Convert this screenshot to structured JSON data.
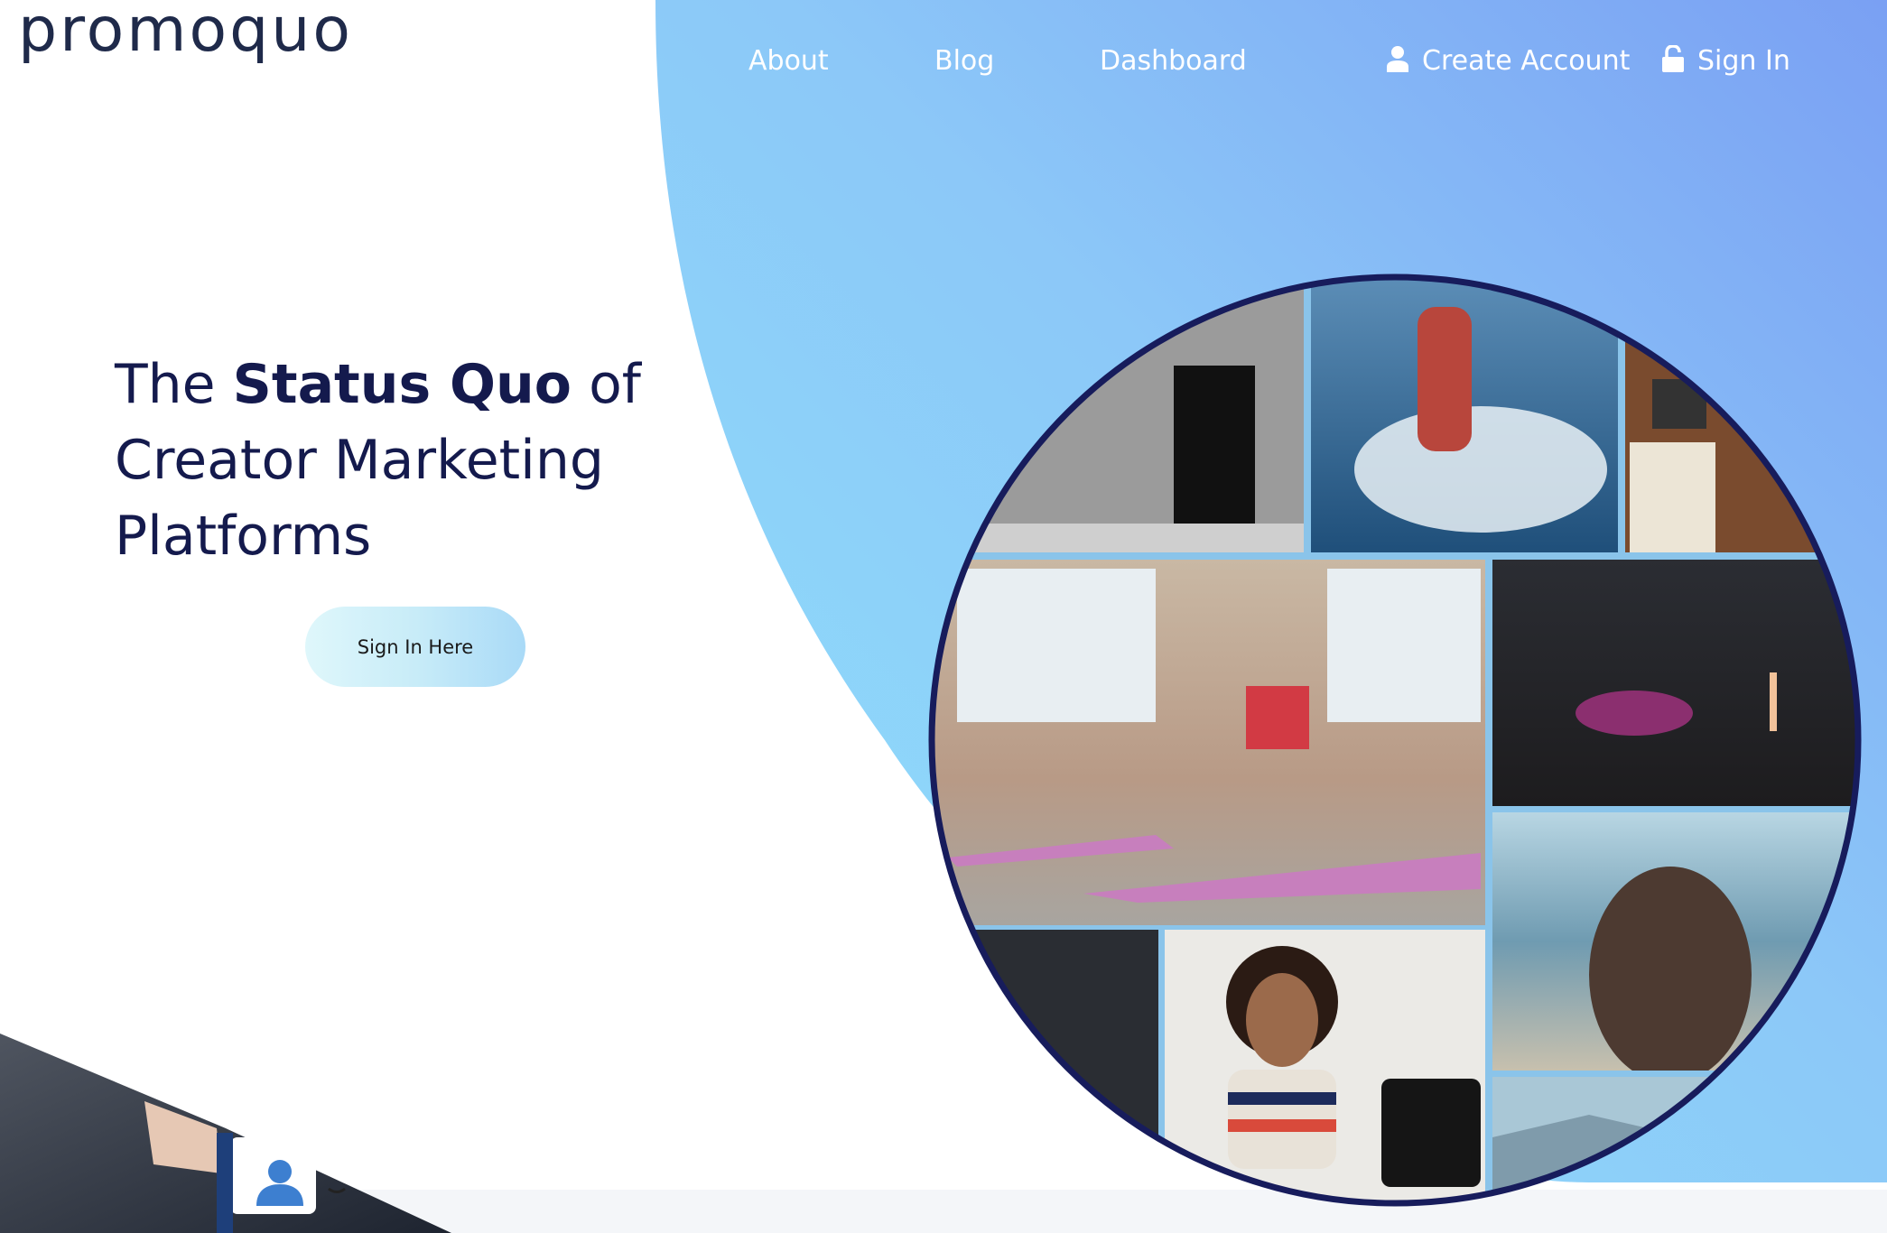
{
  "brand": {
    "logo_text": "promoquo"
  },
  "nav": {
    "about": "About",
    "blog": "Blog",
    "dashboard": "Dashboard",
    "create_account": "Create Account",
    "sign_in": "Sign In"
  },
  "hero": {
    "title_prefix": "The ",
    "title_strong": "Status Quo",
    "title_suffix": " of",
    "title_line2": "Creator Marketing",
    "title_line3": "Platforms",
    "cta_label": "Sign In Here"
  },
  "colors": {
    "navy": "#141a4d",
    "blob_start": "#8fdcf9",
    "blob_end": "#7a9ef4",
    "circle_border": "#171c5c"
  },
  "icons": {
    "create_account": "user-icon",
    "sign_in": "unlock-icon",
    "profile": "user-profile-icon"
  }
}
